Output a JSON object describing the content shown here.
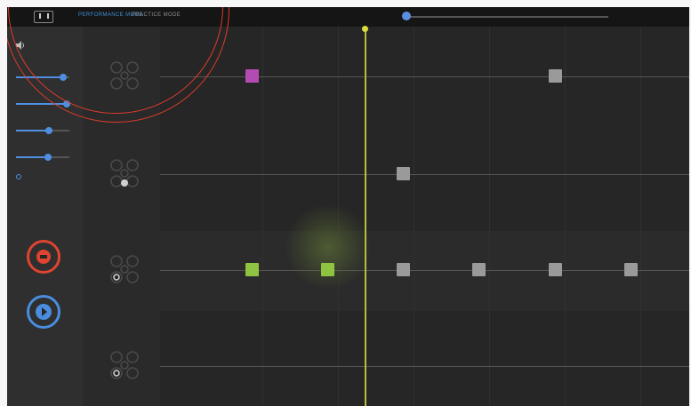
{
  "topbar": {
    "menu_icon": "pause-icon",
    "tabs": [
      {
        "label": "PERFORMANCE MODE",
        "active": true
      },
      {
        "label": "PRACTICE MODE",
        "active": false
      }
    ],
    "progress": 0.02
  },
  "sidebar": {
    "volume_icon": "speaker-icon",
    "sliders": [
      {
        "label": "",
        "value": 0.88
      },
      {
        "label": "",
        "value": 0.95
      },
      {
        "label": "",
        "value": 0.62
      },
      {
        "label": "",
        "value": 0.6
      }
    ],
    "toggle_label": "",
    "record_icon": "record-icon",
    "play_icon": "play-icon"
  },
  "tracks": [
    {
      "name": "",
      "notes": [
        {
          "color": "#b24bb2"
        },
        {
          "color": "#9a9a9a"
        }
      ]
    },
    {
      "name": "",
      "notes": [
        {
          "color": "#9a9a9a"
        }
      ]
    },
    {
      "name": "",
      "notes": [
        {
          "color": "#8fc342"
        },
        {
          "color": "#8fc342"
        },
        {
          "color": "#9a9a9a"
        },
        {
          "color": "#9a9a9a"
        },
        {
          "color": "#9a9a9a"
        },
        {
          "color": "#9a9a9a"
        }
      ]
    },
    {
      "name": "",
      "notes": []
    }
  ],
  "colors": {
    "accent_blue": "#4f8ee0",
    "record_red": "#e04430",
    "playhead": "#c9cf3a",
    "annotation": "#e23c2c"
  }
}
